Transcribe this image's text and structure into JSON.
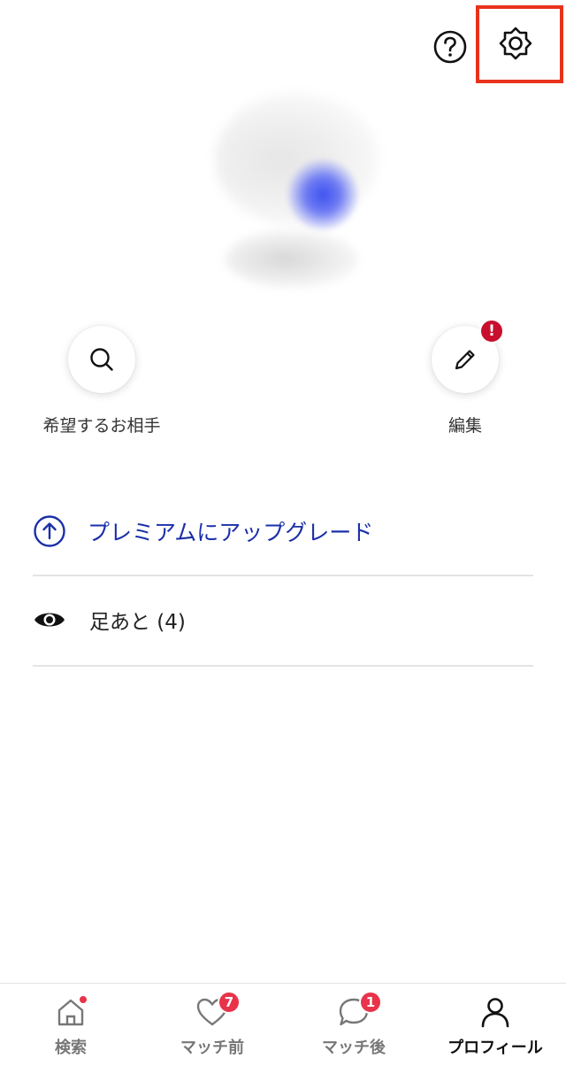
{
  "header": {
    "help_icon": "question-circle-icon",
    "settings_icon": "gear-icon",
    "highlight_color": "#e8321c"
  },
  "actions": {
    "search_label": "希望するお相手",
    "edit_label": "編集",
    "edit_alert": "!"
  },
  "menu": {
    "premium_label": "プレミアムにアップグレード",
    "footprint_label": "足あと (4)",
    "premium_color": "#1a2fa8"
  },
  "tabs": [
    {
      "label": "検索",
      "icon": "home-icon",
      "badge": ""
    },
    {
      "label": "マッチ前",
      "icon": "heart-icon",
      "badge": "7"
    },
    {
      "label": "マッチ後",
      "icon": "chat-bubble-icon",
      "badge": "1"
    },
    {
      "label": "プロフィール",
      "icon": "person-icon",
      "badge": ""
    }
  ],
  "colors": {
    "badge_red": "#e8334a",
    "alert_red": "#c8102e"
  }
}
